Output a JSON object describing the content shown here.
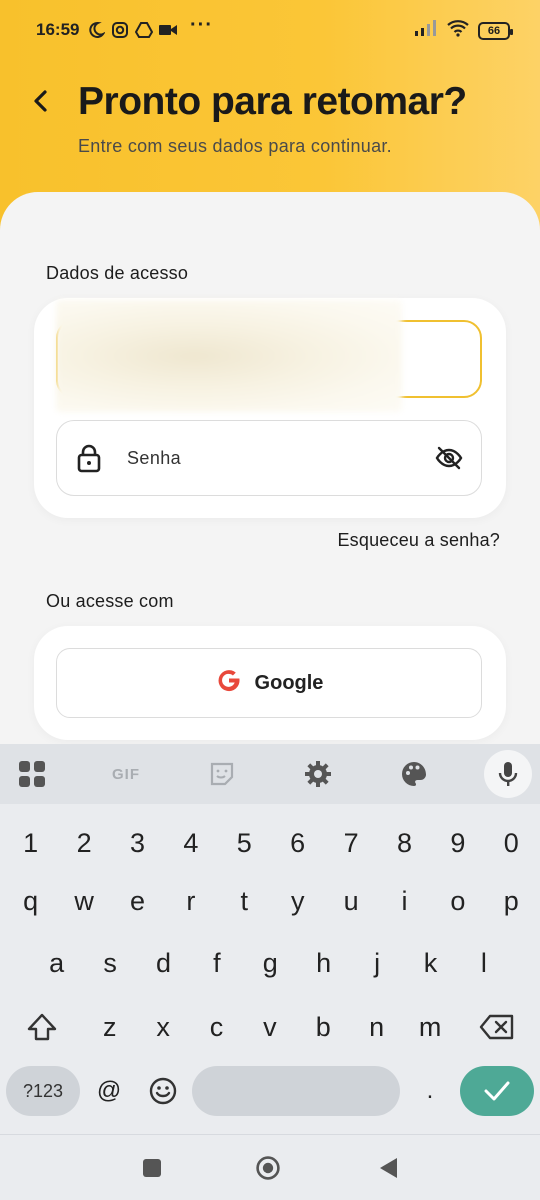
{
  "status_bar": {
    "time": "16:59",
    "dots": "···",
    "battery": "66"
  },
  "header": {
    "title": "Pronto para retomar?",
    "subtitle": "Entre com seus dados para continuar."
  },
  "login": {
    "section_label": "Dados de acesso",
    "password_placeholder": "Senha",
    "forgot_password": "Esqueceu a senha?",
    "alt_label": "Ou acesse com",
    "google_label": "Google"
  },
  "keyboard": {
    "tools": {
      "gif": "GIF"
    },
    "row_numbers": [
      "1",
      "2",
      "3",
      "4",
      "5",
      "6",
      "7",
      "8",
      "9",
      "0"
    ],
    "row_q": [
      "q",
      "w",
      "e",
      "r",
      "t",
      "y",
      "u",
      "i",
      "o",
      "p"
    ],
    "row_a": [
      "a",
      "s",
      "d",
      "f",
      "g",
      "h",
      "j",
      "k",
      "l"
    ],
    "row_z": [
      "z",
      "x",
      "c",
      "v",
      "b",
      "n",
      "m"
    ],
    "sym_key": "?123",
    "at_key": "@",
    "period_key": "."
  },
  "colors": {
    "accent_yellow": "#f8c12c",
    "enter_green": "#4ea996",
    "google_red": "#e8483b"
  }
}
